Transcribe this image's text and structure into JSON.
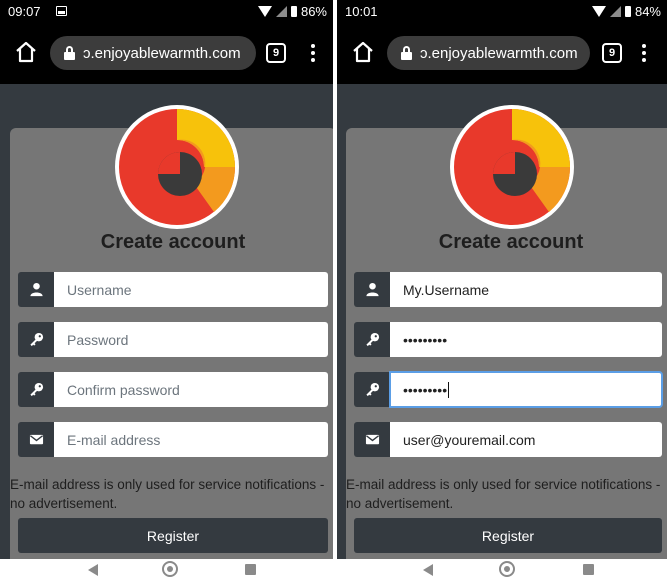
{
  "left": {
    "status": {
      "time": "09:07",
      "battery": "86%"
    },
    "browser": {
      "url": "ɔ.enjoyablewarmth.com",
      "tab_count": "9"
    },
    "form": {
      "title": "Create account",
      "username": {
        "placeholder": "Username",
        "value": ""
      },
      "password": {
        "placeholder": "Password",
        "value": ""
      },
      "confirm_password": {
        "placeholder": "Confirm password",
        "value": ""
      },
      "email": {
        "placeholder": "E-mail address",
        "value": ""
      },
      "note": "E-mail address is only used for service notifications - no advertisement.",
      "register_label": "Register"
    }
  },
  "right": {
    "status": {
      "time": "10:01",
      "battery": "84%"
    },
    "browser": {
      "url": "ɔ.enjoyablewarmth.com",
      "tab_count": "9"
    },
    "form": {
      "title": "Create account",
      "username": {
        "value": "My.Username"
      },
      "password": {
        "value": "•••••••••"
      },
      "confirm_password": {
        "value": "•••••••••"
      },
      "email": {
        "value": "user@youremail.com"
      },
      "note": "E-mail address is only used for service notifications - no advertisement.",
      "register_label": "Register"
    }
  },
  "icons": {
    "username": "user-icon",
    "password": "key-icon",
    "confirm_password": "key-icon",
    "email": "envelope-icon"
  },
  "colors": {
    "page_bg": "#343a40",
    "card_bg": "#767676",
    "logo_outer": "#e8392b",
    "logo_inner": "#f7c20b",
    "focus_ring": "#5b9ee6"
  }
}
